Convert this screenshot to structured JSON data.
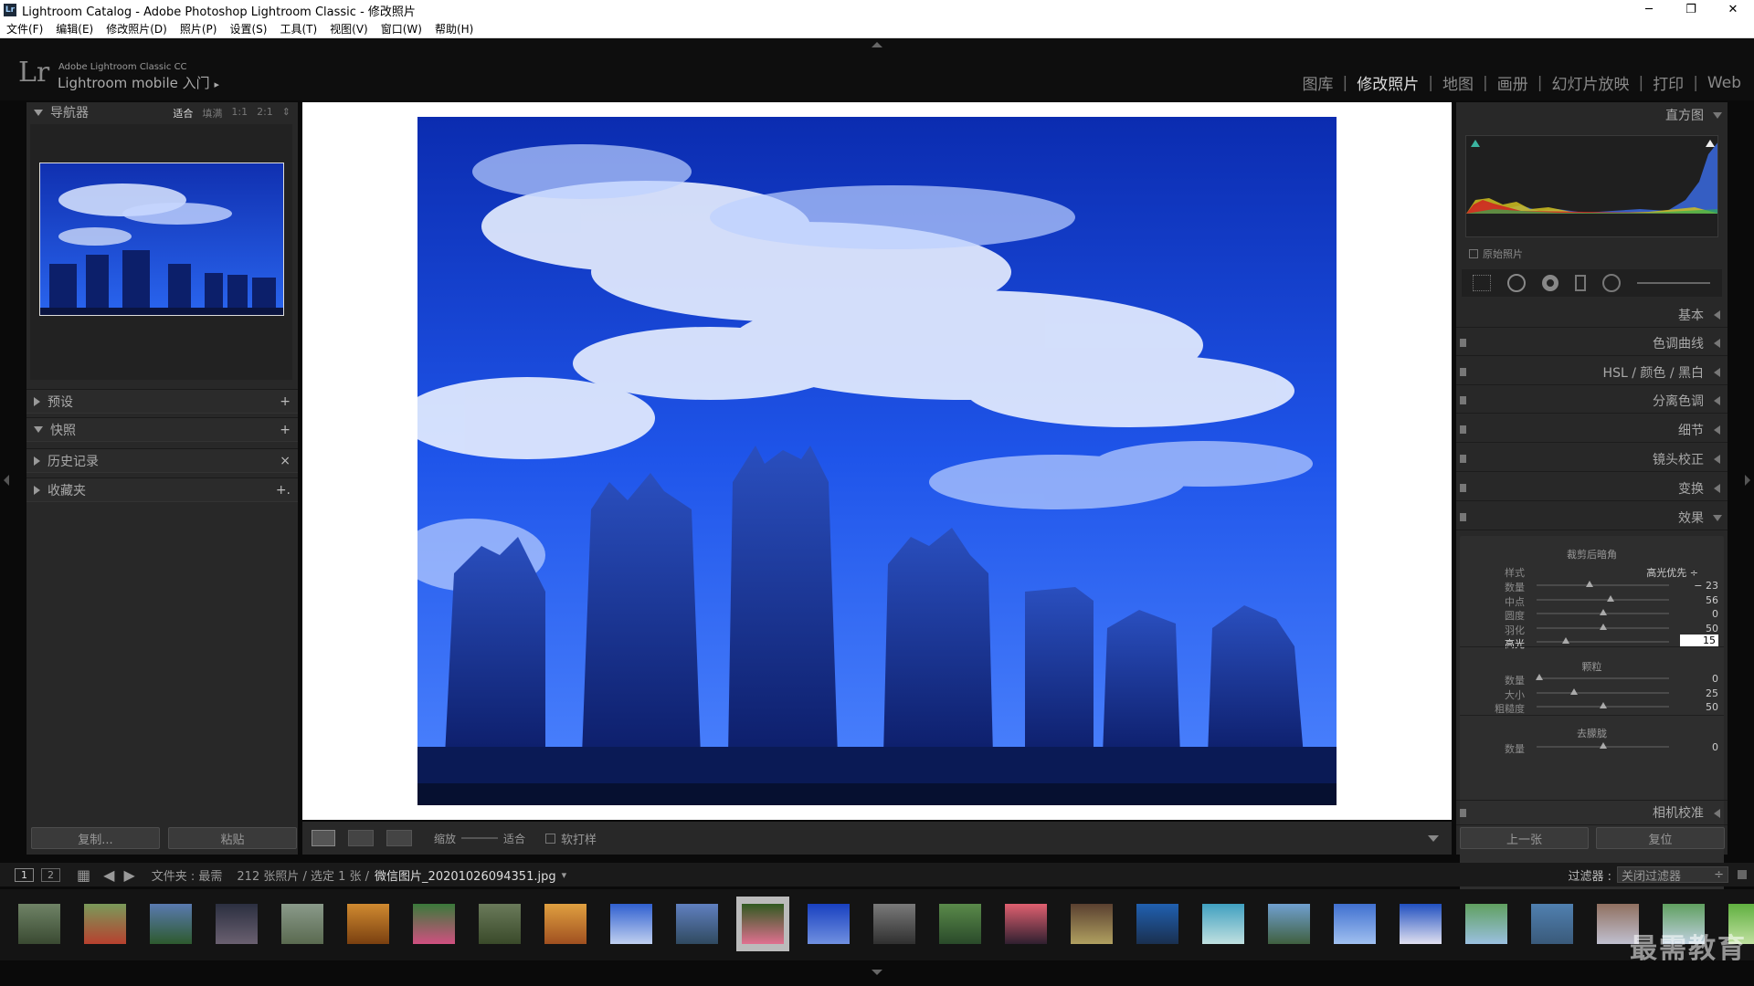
{
  "window": {
    "title": "Lightroom Catalog - Adobe Photoshop Lightroom Classic - 修改照片",
    "icon": "Lr"
  },
  "window_controls": {
    "minimize": "─",
    "restore": "❐",
    "close": "✕"
  },
  "menu": [
    "文件(F)",
    "编辑(E)",
    "修改照片(D)",
    "照片(P)",
    "设置(S)",
    "工具(T)",
    "视图(V)",
    "窗口(W)",
    "帮助(H)"
  ],
  "identity": {
    "logo": "Lr",
    "product": "Adobe Lightroom Classic CC",
    "mobile": "Lightroom mobile 入门",
    "arrow": "▸"
  },
  "modules": [
    {
      "label": "图库",
      "active": false
    },
    {
      "label": "修改照片",
      "active": true
    },
    {
      "label": "地图",
      "active": false
    },
    {
      "label": "画册",
      "active": false
    },
    {
      "label": "幻灯片放映",
      "active": false
    },
    {
      "label": "打印",
      "active": false
    },
    {
      "label": "Web",
      "active": false
    }
  ],
  "left": {
    "navigator": {
      "title": "导航器",
      "zoom": [
        "适合",
        "填满",
        "1:1",
        "2:1"
      ],
      "zoom_selected": "适合",
      "zoom_arrow": "⇕"
    },
    "sections": [
      {
        "label": "预设",
        "action": "+",
        "expanded": false
      },
      {
        "label": "快照",
        "action": "+",
        "expanded": true
      },
      {
        "label": "历史记录",
        "action": "×",
        "expanded": false
      },
      {
        "label": "收藏夹",
        "action": "+.",
        "expanded": false
      }
    ],
    "copy_button": "复制...",
    "paste_button": "粘贴"
  },
  "right": {
    "histogram_title": "直方图",
    "original_photo_label": "原始照片",
    "sections": [
      {
        "label": "基本"
      },
      {
        "label": "色调曲线"
      },
      {
        "label": "HSL / 颜色 / 黑白"
      },
      {
        "label": "分离色调"
      },
      {
        "label": "细节"
      },
      {
        "label": "镜头校正"
      },
      {
        "label": "变换"
      },
      {
        "label": "效果"
      }
    ],
    "vignette": {
      "title": "裁剪后暗角",
      "style_label": "样式",
      "style_value": "高光优先 ÷",
      "sliders": [
        {
          "label": "数量",
          "value": "− 23",
          "pos": 0.4
        },
        {
          "label": "中点",
          "value": "56",
          "pos": 0.56
        },
        {
          "label": "圆度",
          "value": "0",
          "pos": 0.5
        },
        {
          "label": "羽化",
          "value": "50",
          "pos": 0.5
        },
        {
          "label": "高光",
          "value": "15",
          "pos": 0.22
        }
      ]
    },
    "grain": {
      "title": "颗粒",
      "sliders": [
        {
          "label": "数量",
          "value": "0",
          "pos": 0.02
        },
        {
          "label": "大小",
          "value": "25",
          "pos": 0.28
        },
        {
          "label": "粗糙度",
          "value": "50",
          "pos": 0.5
        }
      ]
    },
    "dehaze": {
      "title": "去朦胧",
      "sliders": [
        {
          "label": "数量",
          "value": "0",
          "pos": 0.5
        }
      ]
    },
    "camera_calibration": "相机校准",
    "prev_button": "上一张",
    "reset_button": "复位"
  },
  "toolbar": {
    "zoom_label": "缩放",
    "fit_label": "适合",
    "softproof_label": "软打样"
  },
  "filmstrip_bar": {
    "view1": "1",
    "view2": "2",
    "source": "文件夹 : 最需",
    "count": "212 张照片 / 选定 1 张 /",
    "filename": "微信图片_20201026094351.jpg",
    "filename_arrow": "▾",
    "filter_label": "过滤器 :",
    "filter_value": "关闭过滤器",
    "filter_arrow": "÷"
  },
  "filmstrip": {
    "selected_index": 11,
    "thumbs": [
      {
        "c1": "#6f8366",
        "c2": "#3a4a32"
      },
      {
        "c1": "#7a9a5a",
        "c2": "#b7412f"
      },
      {
        "c1": "#5a7ab0",
        "c2": "#2e5a2e"
      },
      {
        "c1": "#2b2f40",
        "c2": "#6a6070"
      },
      {
        "c1": "#8a9a8a",
        "c2": "#5a6a50"
      },
      {
        "c1": "#d08a30",
        "c2": "#7a4010"
      },
      {
        "c1": "#3a7a3a",
        "c2": "#d05080"
      },
      {
        "c1": "#6a7a5a",
        "c2": "#3a4a2a"
      },
      {
        "c1": "#e0a040",
        "c2": "#a05020"
      },
      {
        "c1": "#3060d0",
        "c2": "#c0d0f0"
      },
      {
        "c1": "#6080c0",
        "c2": "#304a60"
      },
      {
        "c1": "#305a20",
        "c2": "#e07090"
      },
      {
        "c1": "#1840c0",
        "c2": "#7090e0"
      },
      {
        "c1": "#7a7a7a",
        "c2": "#303030"
      },
      {
        "c1": "#5a8a4a",
        "c2": "#2a4a2a"
      },
      {
        "c1": "#e06070",
        "c2": "#302030"
      },
      {
        "c1": "#5a4030",
        "c2": "#b0a060"
      },
      {
        "c1": "#2060b0",
        "c2": "#1a3050"
      },
      {
        "c1": "#40a0c0",
        "c2": "#c0e0e0"
      },
      {
        "c1": "#70a0d0",
        "c2": "#406040"
      },
      {
        "c1": "#4070d0",
        "c2": "#a0c0f0"
      },
      {
        "c1": "#2050c0",
        "c2": "#e0e0f0"
      },
      {
        "c1": "#60a060",
        "c2": "#9ac0e0"
      },
      {
        "c1": "#5080b0",
        "c2": "#3a5a7a"
      },
      {
        "c1": "#907060",
        "c2": "#c0c0d0"
      },
      {
        "c1": "#60a060",
        "c2": "#c0d0e0"
      },
      {
        "c1": "#60b040",
        "c2": "#c0e0a0"
      }
    ]
  },
  "watermark": "最需教育",
  "colors": {
    "accent_sky": "#1c4fe0",
    "panel": "#282828",
    "bg": "#0a0a0a"
  }
}
